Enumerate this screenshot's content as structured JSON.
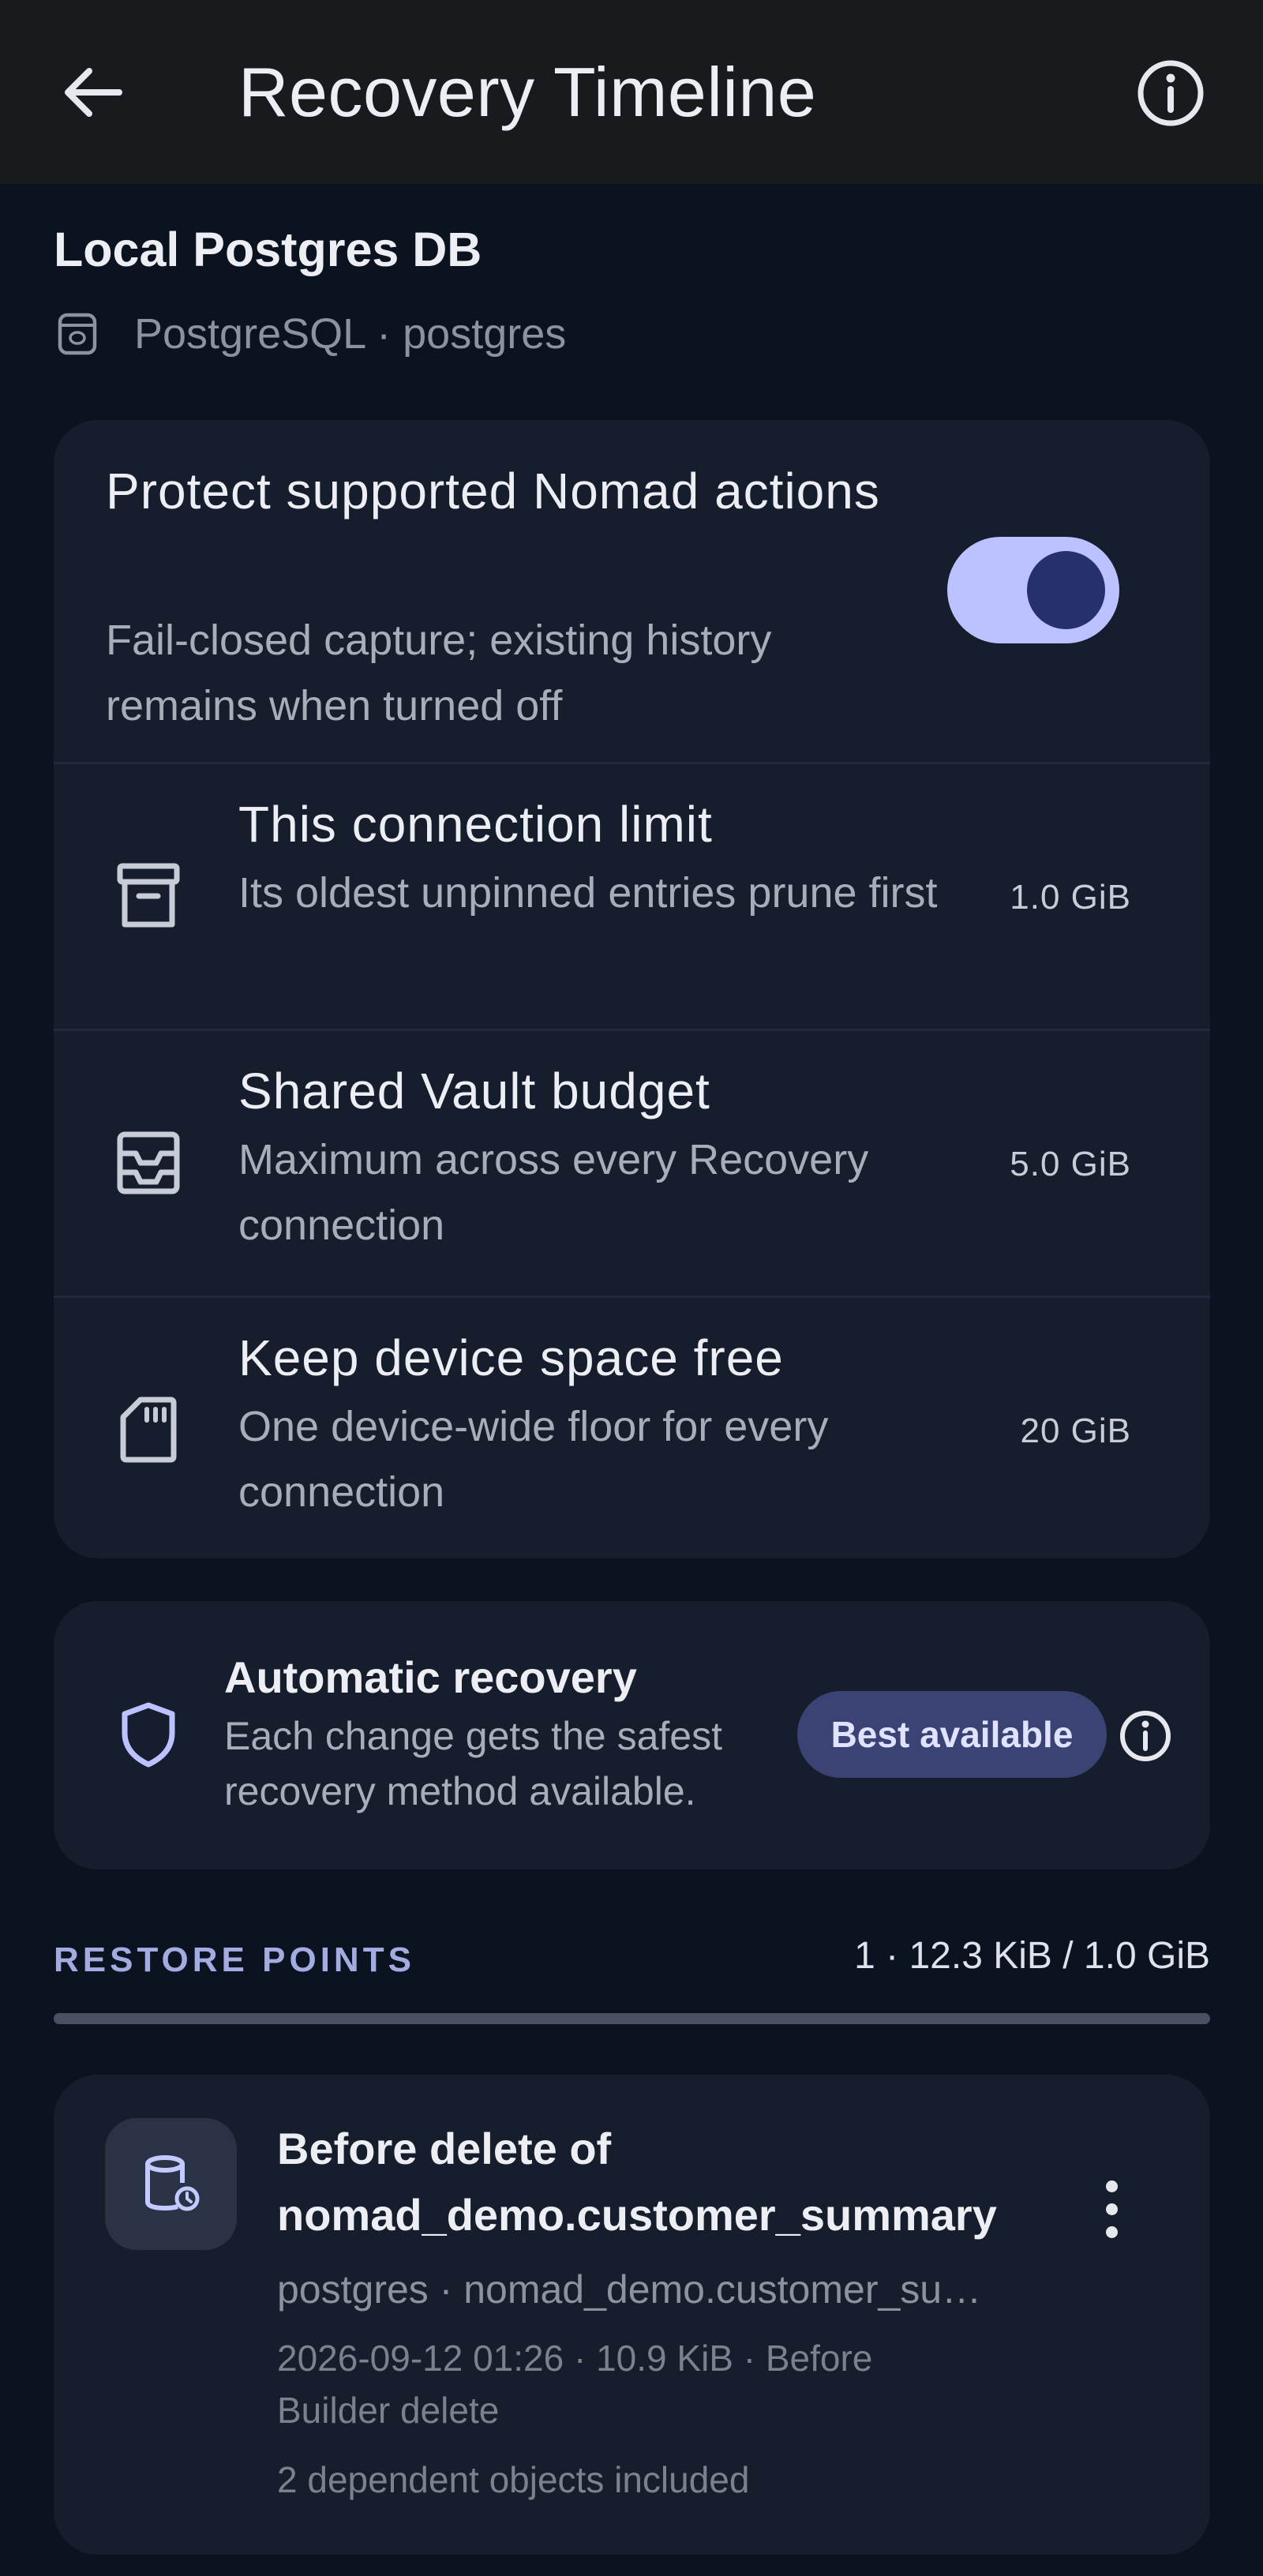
{
  "appbar": {
    "title": "Recovery Timeline",
    "back_icon": "arrow-left-icon",
    "info_icon": "info-icon"
  },
  "connection": {
    "name": "Local Postgres DB",
    "subtitle": "PostgreSQL · postgres",
    "icon": "database-icon"
  },
  "protection": {
    "title": "Protect supported Nomad actions",
    "description": "Fail-closed capture; existing history remains when turned off",
    "enabled": true
  },
  "limits": [
    {
      "icon": "archive-icon",
      "title": "This connection limit",
      "description": "Its oldest unpinned entries prune first",
      "value": "1.0 GiB"
    },
    {
      "icon": "inbox-tray-icon",
      "title": "Shared Vault budget",
      "description": "Maximum across every Recovery connection",
      "value": "5.0 GiB"
    },
    {
      "icon": "sd-card-icon",
      "title": "Keep device space free",
      "description": "One device-wide floor for every connection",
      "value": "20 GiB"
    }
  ],
  "automatic_recovery": {
    "icon": "shield-icon",
    "title": "Automatic recovery",
    "description": "Each change gets the safest recovery method available.",
    "badge": "Best available",
    "info_icon": "info-icon"
  },
  "restore_points": {
    "section_label": "RESTORE POINTS",
    "usage_text": "1 · 12.3 KiB / 1.0 GiB",
    "usage_fraction": 1e-05,
    "items": [
      {
        "icon": "database-restore-icon",
        "title": "Before delete of nomad_demo.customer_summary",
        "meta": "postgres · nomad_demo.customer_su…",
        "details": "2026-09-12 01:26 · 10.9 KiB · Before Builder delete",
        "dependents": "2 dependent objects included",
        "menu_icon": "more-vertical-icon"
      }
    ]
  },
  "colors": {
    "background": "#0b1320",
    "appbar": "#181a1e",
    "card": "#161e2d",
    "accent": "#bcc2ff",
    "badge": "#3b4274"
  }
}
